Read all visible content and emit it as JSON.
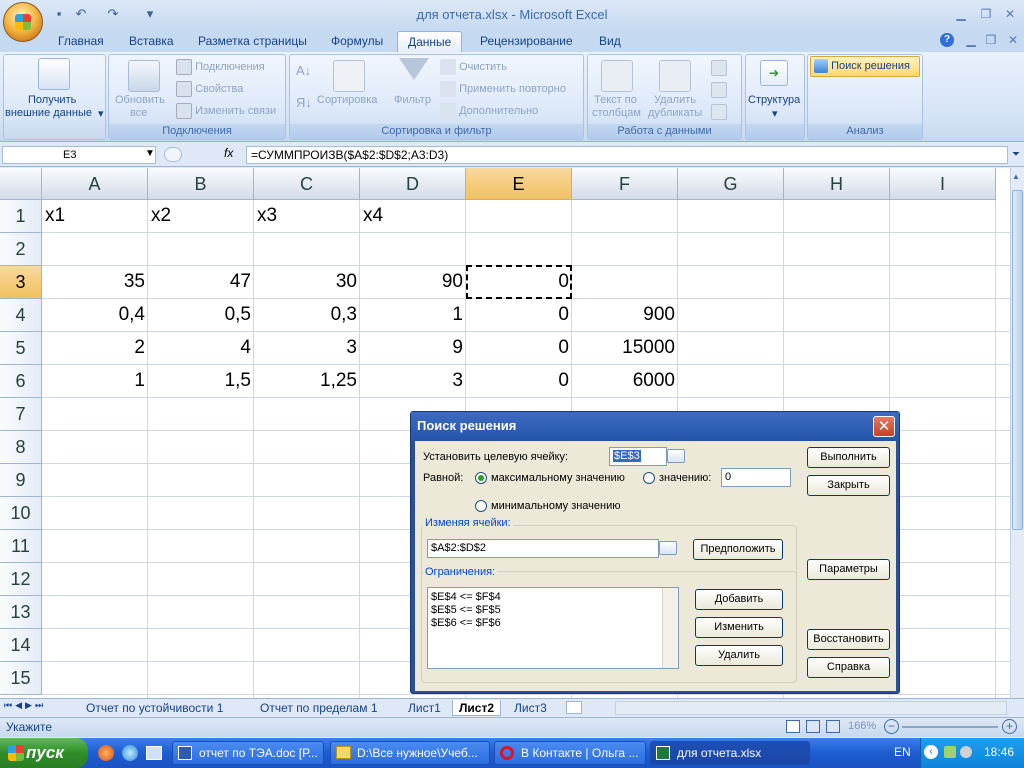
{
  "window": {
    "title": "для отчета.xlsx - Microsoft Excel"
  },
  "ribbon": {
    "tabs": [
      "Главная",
      "Вставка",
      "Разметка страницы",
      "Формулы",
      "Данные",
      "Рецензирование",
      "Вид"
    ],
    "active_tab": "Данные",
    "get_external": "Получить\nвнешние данные",
    "get_external_l1": "Получить",
    "get_external_l2": "внешние данные",
    "refresh_l1": "Обновить",
    "refresh_l2": "все",
    "connections": "Подключения",
    "properties": "Свойства",
    "edit_links": "Изменить связи",
    "group_connections": "Подключения",
    "sort": "Сортировка",
    "filter": "Фильтр",
    "clear": "Очистить",
    "reapply": "Применить повторно",
    "advanced": "Дополнительно",
    "group_sort": "Сортировка и фильтр",
    "text_cols_l1": "Текст по",
    "text_cols_l2": "столбцам",
    "remove_dup_l1": "Удалить",
    "remove_dup_l2": "дубликаты",
    "group_data": "Работа с данными",
    "outline": "Структура",
    "solver": "Поиск решения",
    "group_analysis": "Анализ"
  },
  "formula_bar": {
    "name_box": "E3",
    "fx": "fx",
    "formula": "=СУММПРОИЗВ($A$2:$D$2;A3:D3)"
  },
  "grid": {
    "columns": [
      "A",
      "B",
      "C",
      "D",
      "E",
      "F",
      "G",
      "H",
      "I"
    ],
    "rows": [
      "1",
      "2",
      "3",
      "4",
      "5",
      "6",
      "7",
      "8",
      "9",
      "10",
      "11",
      "12",
      "13",
      "14",
      "15"
    ],
    "cells": {
      "A1": "x1",
      "B1": "x2",
      "C1": "x3",
      "D1": "x4",
      "A3": "35",
      "B3": "47",
      "C3": "30",
      "D3": "90",
      "E3": "0",
      "A4": "0,4",
      "B4": "0,5",
      "C4": "0,3",
      "D4": "1",
      "E4": "0",
      "F4": "900",
      "A5": "2",
      "B5": "4",
      "C5": "3",
      "D5": "9",
      "E5": "0",
      "F5": "15000",
      "A6": "1",
      "B6": "1,5",
      "C6": "1,25",
      "D6": "3",
      "E6": "0",
      "F6": "6000"
    }
  },
  "sheet_tabs": [
    "Отчет по устойчивости 1",
    "Отчет по пределам 1",
    "Лист1",
    "Лист2",
    "Лист3"
  ],
  "active_sheet": "Лист2",
  "status": {
    "mode": "Укажите",
    "zoom": "166%"
  },
  "dialog": {
    "title": "Поиск решения",
    "target_label": "Установить целевую ячейку:",
    "target_value": "$E$3",
    "equal_label": "Равной:",
    "opt_max": "максимальному значению",
    "opt_value": "значению:",
    "value_input": "0",
    "opt_min": "минимальному значению",
    "changing_label": "Изменяя ячейки:",
    "changing_value": "$A$2:$D$2",
    "constraints_label": "Ограничения:",
    "constraints": [
      "$E$4 <= $F$4",
      "$E$5 <= $F$5",
      "$E$6 <= $F$6"
    ],
    "btn_solve": "Выполнить",
    "btn_close": "Закрыть",
    "btn_guess": "Предположить",
    "btn_options": "Параметры",
    "btn_add": "Добавить",
    "btn_change": "Изменить",
    "btn_delete": "Удалить",
    "btn_reset": "Восстановить",
    "btn_help": "Справка"
  },
  "taskbar": {
    "start": "пуск",
    "tasks": [
      "отчет по ТЭА.doc [Р...",
      "D:\\Все нужное\\Учеб...",
      "В Контакте | Ольга ...",
      "для отчета.xlsx"
    ],
    "lang": "EN",
    "time": "18:46"
  }
}
